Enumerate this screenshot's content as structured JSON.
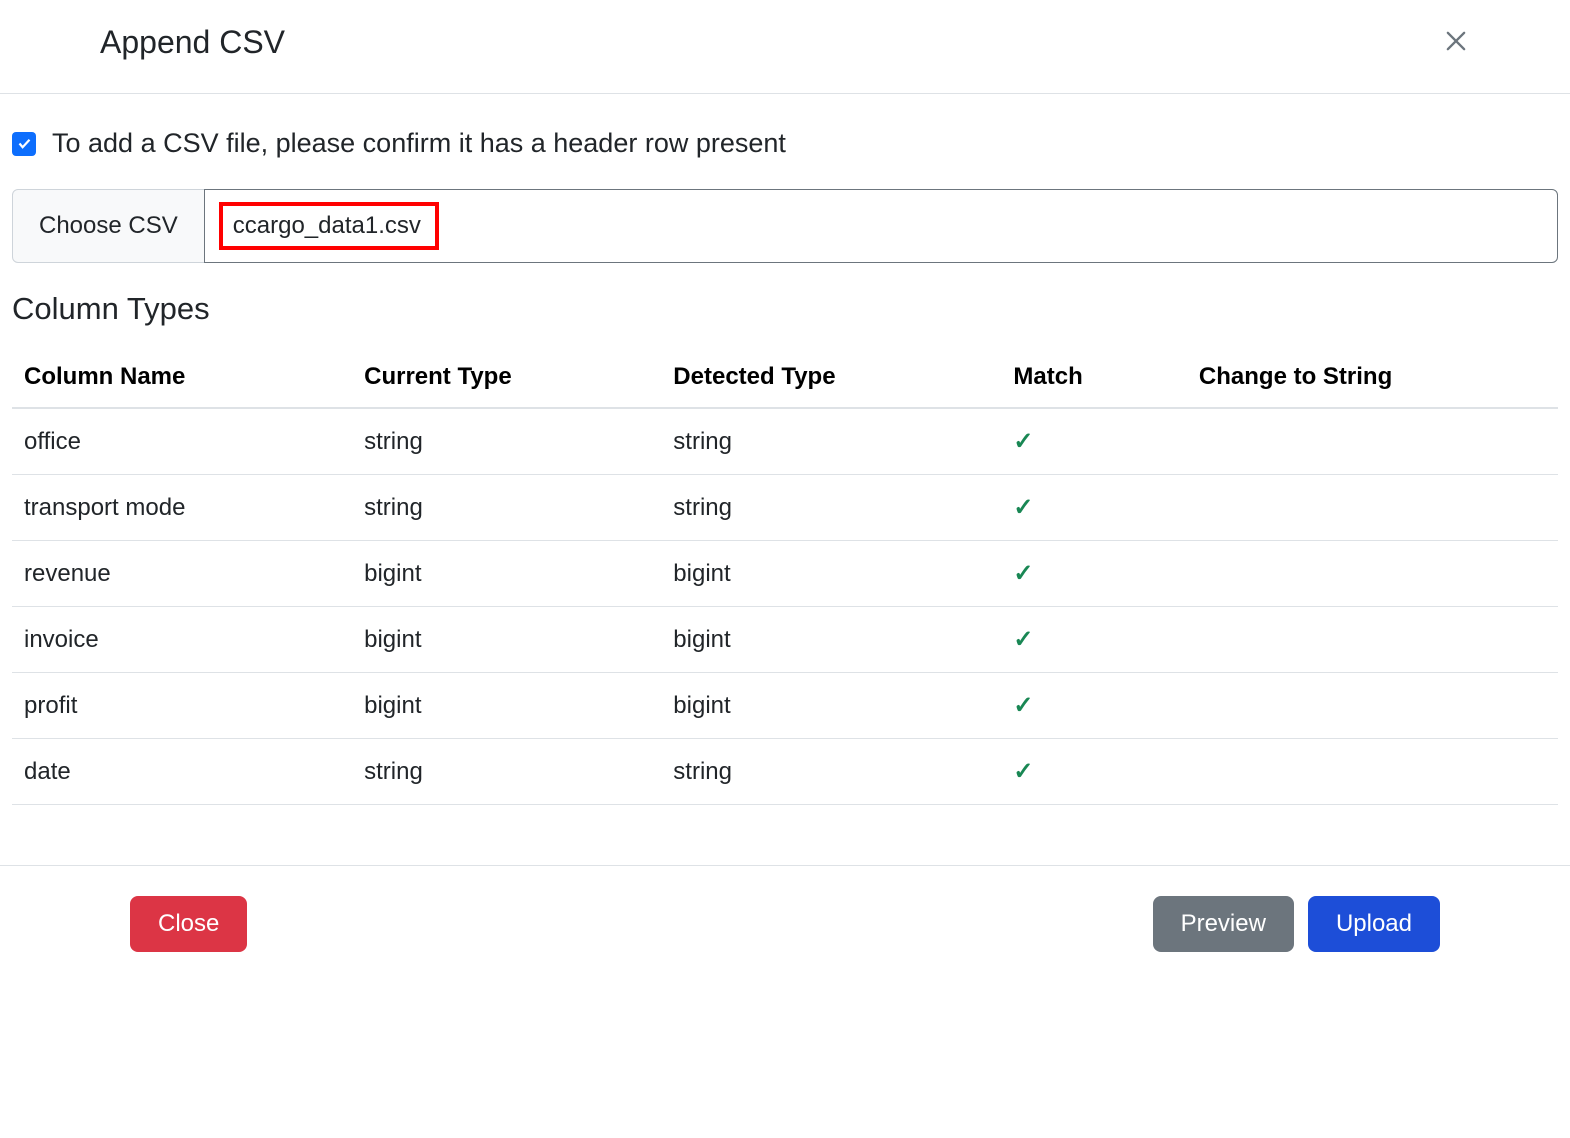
{
  "modal": {
    "title": "Append CSV"
  },
  "confirm": {
    "text": "To add a CSV file, please confirm it has a header row present",
    "checked": true
  },
  "file": {
    "choose_label": "Choose CSV",
    "filename": "ccargo_data1.csv"
  },
  "section": {
    "title": "Column Types"
  },
  "table": {
    "headers": {
      "name": "Column Name",
      "current": "Current Type",
      "detected": "Detected Type",
      "match": "Match",
      "change": "Change to String"
    },
    "rows": [
      {
        "name": "office",
        "current": "string",
        "detected": "string",
        "match": "✓",
        "change": ""
      },
      {
        "name": "transport mode",
        "current": "string",
        "detected": "string",
        "match": "✓",
        "change": ""
      },
      {
        "name": "revenue",
        "current": "bigint",
        "detected": "bigint",
        "match": "✓",
        "change": ""
      },
      {
        "name": "invoice",
        "current": "bigint",
        "detected": "bigint",
        "match": "✓",
        "change": ""
      },
      {
        "name": "profit",
        "current": "bigint",
        "detected": "bigint",
        "match": "✓",
        "change": ""
      },
      {
        "name": "date",
        "current": "string",
        "detected": "string",
        "match": "✓",
        "change": ""
      }
    ]
  },
  "footer": {
    "close": "Close",
    "preview": "Preview",
    "upload": "Upload"
  }
}
